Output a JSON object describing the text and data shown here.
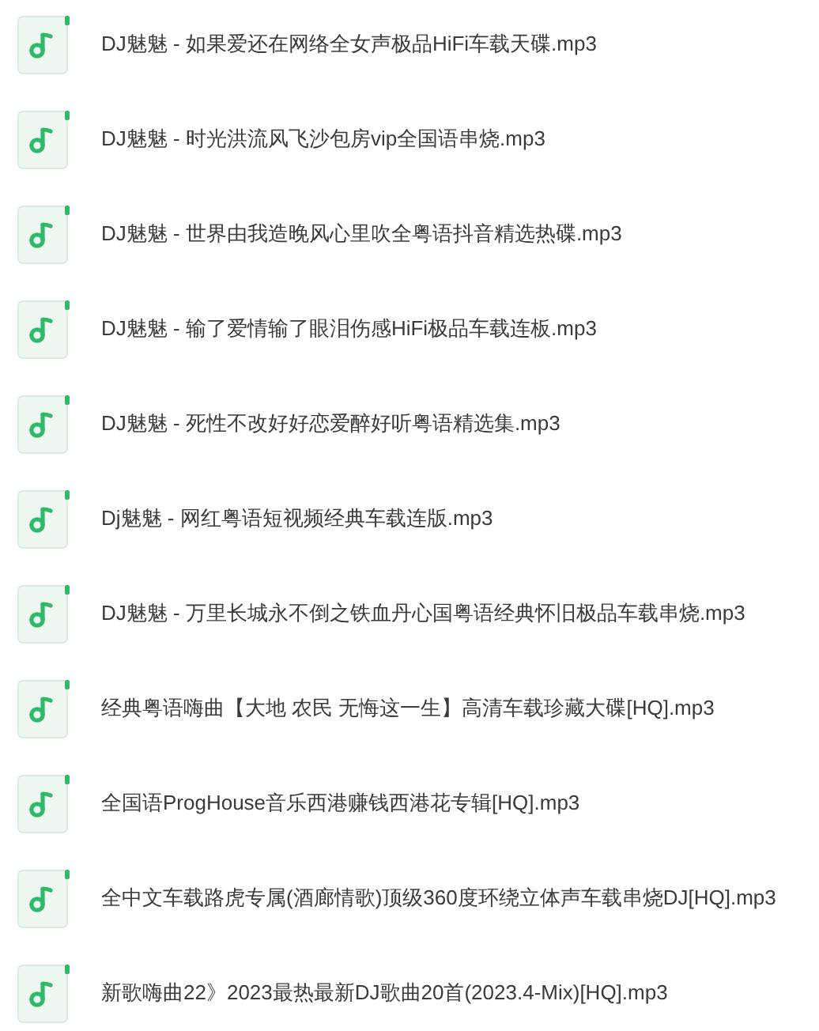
{
  "files": [
    {
      "name": "DJ魅魅 - 如果爱还在网络全女声极品HiFi车载天碟.mp3"
    },
    {
      "name": "DJ魅魅 - 时光洪流风飞沙包房vip全国语串烧.mp3"
    },
    {
      "name": "DJ魅魅 - 世界由我造晚风心里吹全粤语抖音精选热碟.mp3"
    },
    {
      "name": "DJ魅魅 - 输了爱情输了眼泪伤感HiFi极品车载连板.mp3"
    },
    {
      "name": "DJ魅魅 - 死性不改好好恋爱醉好听粤语精选集.mp3"
    },
    {
      "name": "Dj魅魅 - 网红粤语短视频经典车载连版.mp3"
    },
    {
      "name": "DJ魅魅 - 万里长城永不倒之铁血丹心国粤语经典怀旧极品车载串烧.mp3"
    },
    {
      "name": "经典粤语嗨曲【大地 农民 无悔这一生】高清车载珍藏大碟[HQ].mp3"
    },
    {
      "name": "全国语ProgHouse音乐西港赚钱西港花专辑[HQ].mp3"
    },
    {
      "name": "全中文车载路虎专属(酒廊情歌)顶级360度环绕立体声车载串烧DJ[HQ].mp3"
    },
    {
      "name": "新歌嗨曲22》2023最热最新DJ歌曲20首(2023.4-Mix)[HQ].mp3"
    }
  ]
}
